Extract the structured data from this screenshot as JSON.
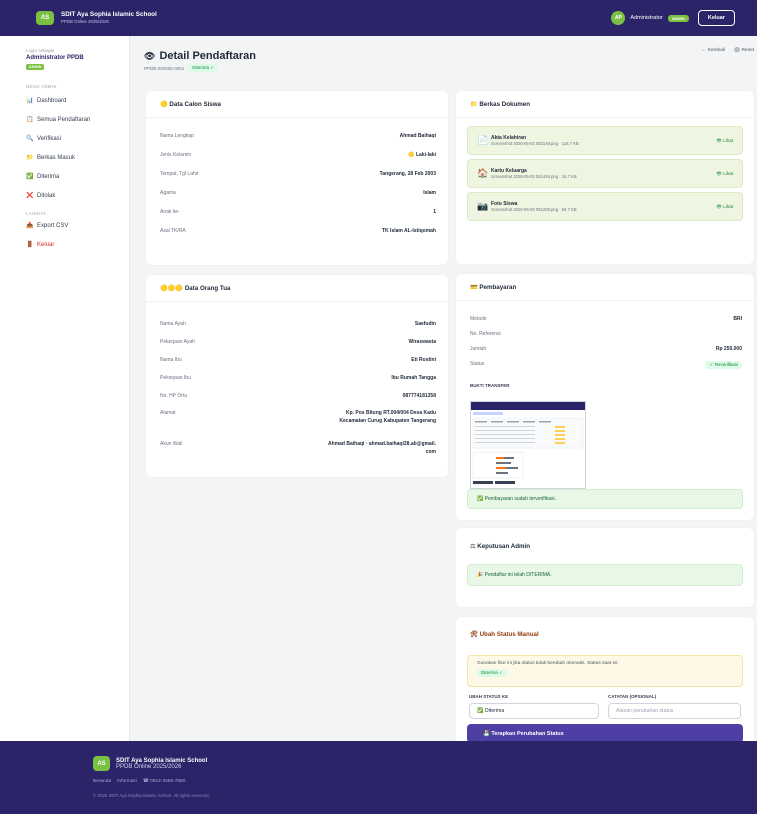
{
  "topbar": {
    "logo": "AS",
    "school": "SDIT Aya Sophia Islamic School",
    "sub": "PPDB Online 2025/2026",
    "avatar": "AP",
    "user": "Administrator",
    "role": "ADMIN",
    "logout": "Keluar"
  },
  "sidebar": {
    "login_as": "Login sebagai",
    "title": "Administrator PPDB",
    "badge": "ADMIN",
    "menu_label": "MENU ADMIN",
    "menu": [
      {
        "icon": "📊",
        "label": "Dashboard"
      },
      {
        "icon": "📋",
        "label": "Semua Pendaftaran"
      },
      {
        "icon": "🔍",
        "label": "Verifikasi"
      },
      {
        "icon": "📁",
        "label": "Berkas Masuk"
      },
      {
        "icon": "✅",
        "label": "Diterima"
      },
      {
        "icon": "❌",
        "label": "Ditolak"
      }
    ],
    "lainnya_label": "LAINNYA",
    "export": {
      "icon": "📥",
      "label": "Export CSV"
    },
    "keluar": {
      "icon": "🚪",
      "label": "Keluar"
    }
  },
  "page": {
    "title": "Detail Pendaftaran",
    "reg_no": "PPDB-202605-0001",
    "status": "Diterima ✓",
    "back": "← Kembali",
    "print": "🖨 Reset"
  },
  "siswa": {
    "header": "🟡 Data Calon Siswa",
    "rows": [
      {
        "k": "Nama Lengkap",
        "v": "Ahmad Baihaqi"
      },
      {
        "k": "Jenis Kelamin",
        "v": "🟡 Laki-laki"
      },
      {
        "k": "Tempat, Tgl Lahir",
        "v": "Tangerang, 28 Feb 2003"
      },
      {
        "k": "Agama",
        "v": "Islam"
      },
      {
        "k": "Anak ke-",
        "v": "1"
      },
      {
        "k": "Asal TK/RA",
        "v": "TK Islam AL-Istiqomah"
      }
    ]
  },
  "ortu": {
    "header": "🟡🟡🟡 Data Orang Tua",
    "rows": [
      {
        "k": "Nama Ayah",
        "v": "Saefudin"
      },
      {
        "k": "Pekerjaan Ayah",
        "v": "Wiraswasta"
      },
      {
        "k": "Nama Ibu",
        "v": "Eti Rostini"
      },
      {
        "k": "Pekerjaan Ibu",
        "v": "Ibu Rumah Tangga"
      },
      {
        "k": "No. HP Ortu",
        "v": "087774181358"
      },
      {
        "k": "Alamat",
        "v": "Kp. Pos Bitung RT.004/004 Desa Kadu Kecamatan Curug Kabupaten Tangerang"
      },
      {
        "k": "Akun Wali",
        "v": "Ahmad Baihaqi · ahmad.baihaqi28.ab@gmail.com"
      }
    ]
  },
  "berkas": {
    "header": "📁 Berkas Dokumen",
    "docs": [
      {
        "icon": "📄",
        "name": "Akta Kelahiran",
        "file": "Screenshot 2026-05-03 083148.png · 116.7 KB",
        "link": "👁 Lihat"
      },
      {
        "icon": "🏠",
        "name": "Kartu Keluarga",
        "file": "Screenshot 2026-05-03 081449.png · 18.7 KB",
        "link": "👁 Lihat"
      },
      {
        "icon": "📷",
        "name": "Foto Siswa",
        "file": "Screenshot 2026-05-03 081200.png · 84.7 KB",
        "link": "👁 Lihat"
      }
    ]
  },
  "bayar": {
    "header": "💳 Pembayaran",
    "rows": [
      {
        "k": "Metode",
        "v": "BRI"
      },
      {
        "k": "No. Referensi",
        "v": ""
      },
      {
        "k": "Jumlah",
        "v": "Rp 250.000"
      }
    ],
    "status_k": "Status",
    "status_v": "✓ Terverifikasi",
    "proof_label": "BUKTI TRANSFER",
    "ok": "✅ Pembayaran sudah terverifikasi."
  },
  "keputusan": {
    "header": "⚖ Keputusan Admin",
    "msg": "🎉 Pendaftar ini telah DITERIMA."
  },
  "ubah": {
    "header": "🛠 Ubah Status Manual",
    "warn": "Gunakan fitur ini jika status tidak berubah otomatis. Status saat ini:",
    "current": "Diterima ✓",
    "status_label": "UBAH STATUS KE",
    "status_value": "✅ Diterima",
    "note_label": "CATATAN (OPSIONAL)",
    "note_placeholder": "Alasan perubahan status",
    "apply": "💾 Terapkan Perubahan Status"
  },
  "footer": {
    "logo": "AS",
    "name": "SDIT Aya Sophia Islamic School",
    "sub": "PPDB Online 2025/2026",
    "links": [
      "Beranda",
      "Informasi",
      "☎ 0812-3456-7890"
    ],
    "copy": "© 2025 SDIT Aya Sophia Islamic School. All rights reserved."
  }
}
